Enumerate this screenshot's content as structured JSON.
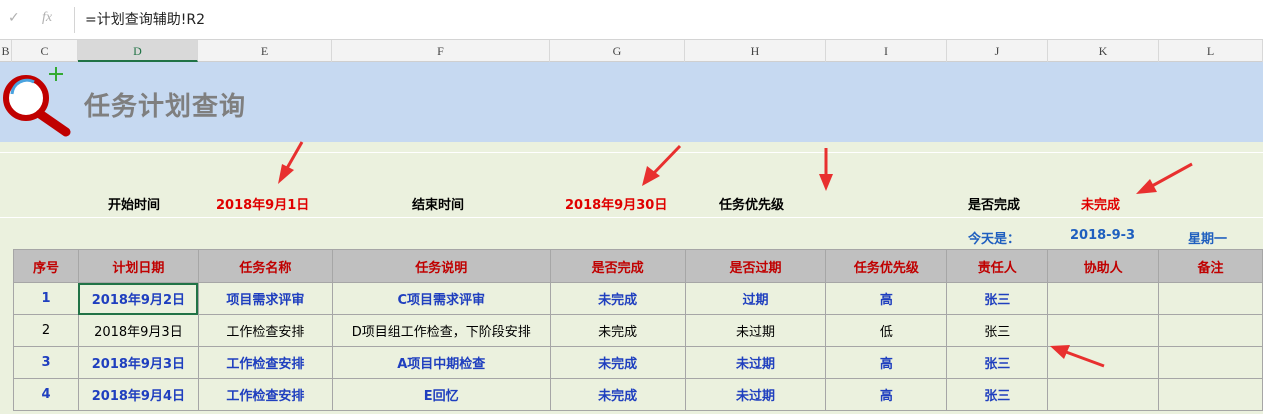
{
  "formula_bar": {
    "cancel_icon": "✓",
    "fx_label": "fx",
    "formula": "=计划查询辅助!R2"
  },
  "columns": [
    "B",
    "C",
    "D",
    "E",
    "F",
    "G",
    "H",
    "I",
    "J",
    "K",
    "L"
  ],
  "active_column": "D",
  "banner": {
    "title": "任务计划查询",
    "icon": "magnifier-icon"
  },
  "filters": {
    "start_label": "开始时间",
    "start_value": "2018年9月1日",
    "end_label": "结束时间",
    "end_value": "2018年9月30日",
    "priority_label": "任务优先级",
    "priority_value": "",
    "complete_label": "是否完成",
    "complete_value": "未完成"
  },
  "today": {
    "label": "今天是：",
    "date": "2018-9-3",
    "weekday": "星期一"
  },
  "table": {
    "headers": [
      "序号",
      "计划日期",
      "任务名称",
      "任务说明",
      "是否完成",
      "是否过期",
      "任务优先级",
      "责任人",
      "协助人",
      "备注"
    ],
    "rows": [
      [
        "1",
        "2018年9月2日",
        "项目需求评审",
        "C项目需求评审",
        "未完成",
        "过期",
        "高",
        "张三",
        "",
        ""
      ],
      [
        "2",
        "2018年9月3日",
        "工作检查安排",
        "D项目组工作检查，下阶段安排",
        "未完成",
        "未过期",
        "低",
        "张三",
        "",
        ""
      ],
      [
        "3",
        "2018年9月3日",
        "工作检查安排",
        "A项目中期检查",
        "未完成",
        "未过期",
        "高",
        "张三",
        "",
        ""
      ],
      [
        "4",
        "2018年9月4日",
        "工作检查安排",
        "E回忆",
        "未完成",
        "未过期",
        "高",
        "张三",
        "",
        ""
      ]
    ]
  },
  "colors": {
    "banner": "#c6d9f1",
    "sheet": "#ebf1de",
    "header_text": "#c00000",
    "highlight": "#e00000",
    "blue": "#1f3fbf",
    "arrow": "#e8302f"
  }
}
